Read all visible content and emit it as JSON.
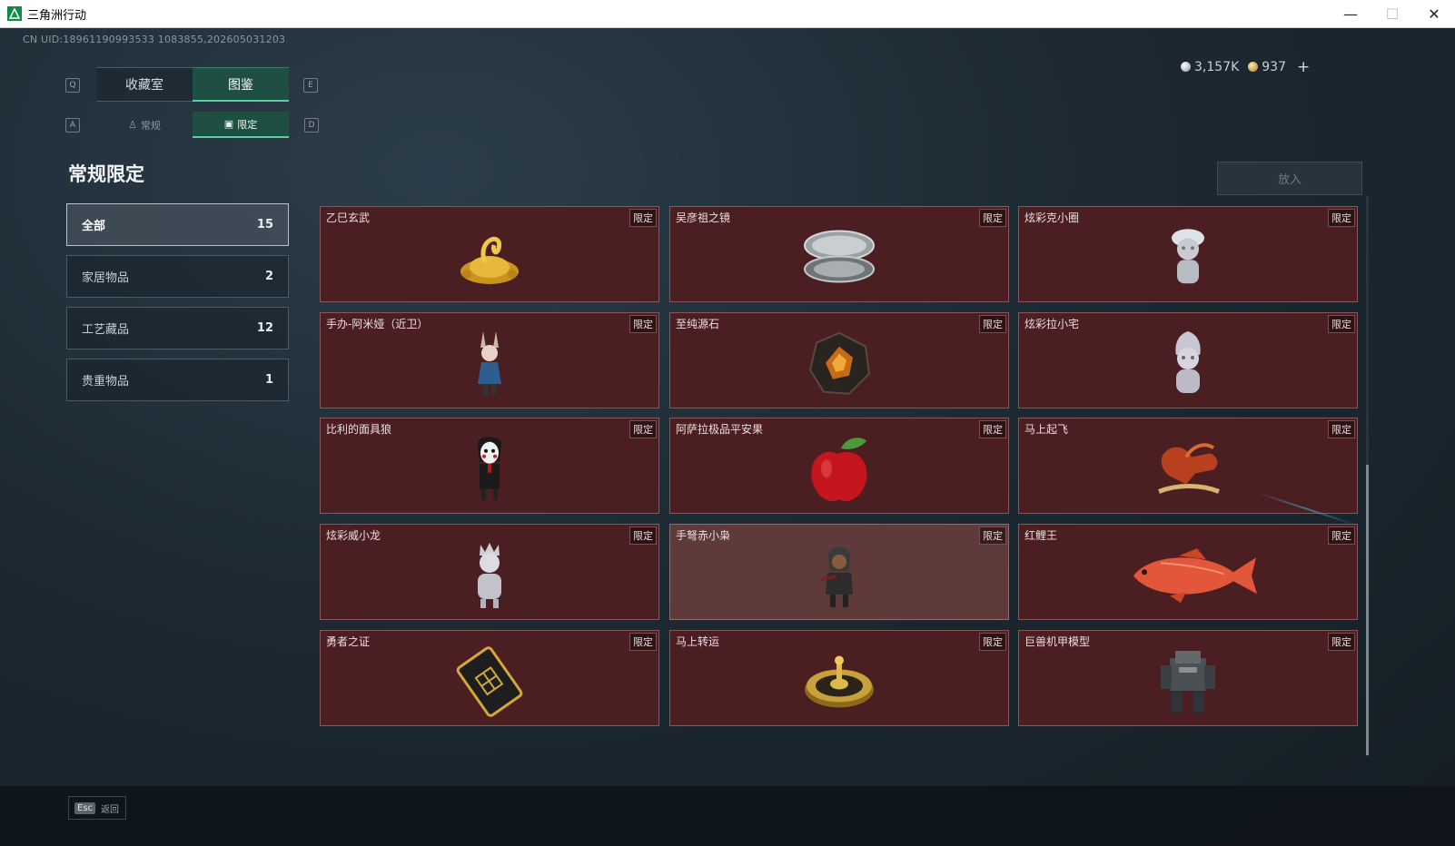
{
  "window": {
    "title": "三角洲行动",
    "minimize": "—",
    "maximize": "☐",
    "close": "✕"
  },
  "uid": "CN UID:18961190993533 1083855,202605031203",
  "currency": {
    "silver": "3,157K",
    "gold": "937",
    "plus": "+"
  },
  "keys": {
    "q": "Q",
    "e": "E",
    "a": "A",
    "d": "D"
  },
  "top_tabs": [
    {
      "label": "收藏室"
    },
    {
      "label": "图鉴"
    }
  ],
  "sub_tabs": [
    {
      "label": "常规"
    },
    {
      "label": "限定"
    }
  ],
  "page_title": "常规限定",
  "action_button": "放入",
  "categories": [
    {
      "label": "全部",
      "count": "15"
    },
    {
      "label": "家居物品",
      "count": "2"
    },
    {
      "label": "工艺藏品",
      "count": "12"
    },
    {
      "label": "贵重物品",
      "count": "1"
    }
  ],
  "badge": "限定",
  "items": [
    {
      "name": "乙巳玄武",
      "icon": "golden-serpent-turtle-icon"
    },
    {
      "name": "吴彦祖之镜",
      "icon": "compact-mirror-icon"
    },
    {
      "name": "炫彩克小圈",
      "icon": "chrome-figurine-icon"
    },
    {
      "name": "手办-阿米娅（近卫）",
      "icon": "amiya-figure-icon"
    },
    {
      "name": "至纯源石",
      "icon": "originium-stone-icon"
    },
    {
      "name": "炫彩拉小宅",
      "icon": "chrome-figurine-icon"
    },
    {
      "name": "比利的面具狼",
      "icon": "billy-puppet-icon"
    },
    {
      "name": "阿萨拉极品平安果",
      "icon": "red-apple-icon"
    },
    {
      "name": "马上起飞",
      "icon": "flying-horse-icon"
    },
    {
      "name": "炫彩威小龙",
      "icon": "chrome-figurine-icon"
    },
    {
      "name": "手弩赤小枭",
      "icon": "crossbow-figure-icon"
    },
    {
      "name": "红鲤王",
      "icon": "red-carp-icon"
    },
    {
      "name": "勇者之证",
      "icon": "hero-card-icon"
    },
    {
      "name": "马上转运",
      "icon": "golden-wheel-icon"
    },
    {
      "name": "巨兽机甲模型",
      "icon": "mech-model-icon"
    }
  ],
  "escape": {
    "key": "Esc",
    "label": "返回"
  },
  "colors": {
    "accent": "#57d29a",
    "card_bg": "#4b1e22",
    "card_highlight": "#5e3a3a"
  }
}
